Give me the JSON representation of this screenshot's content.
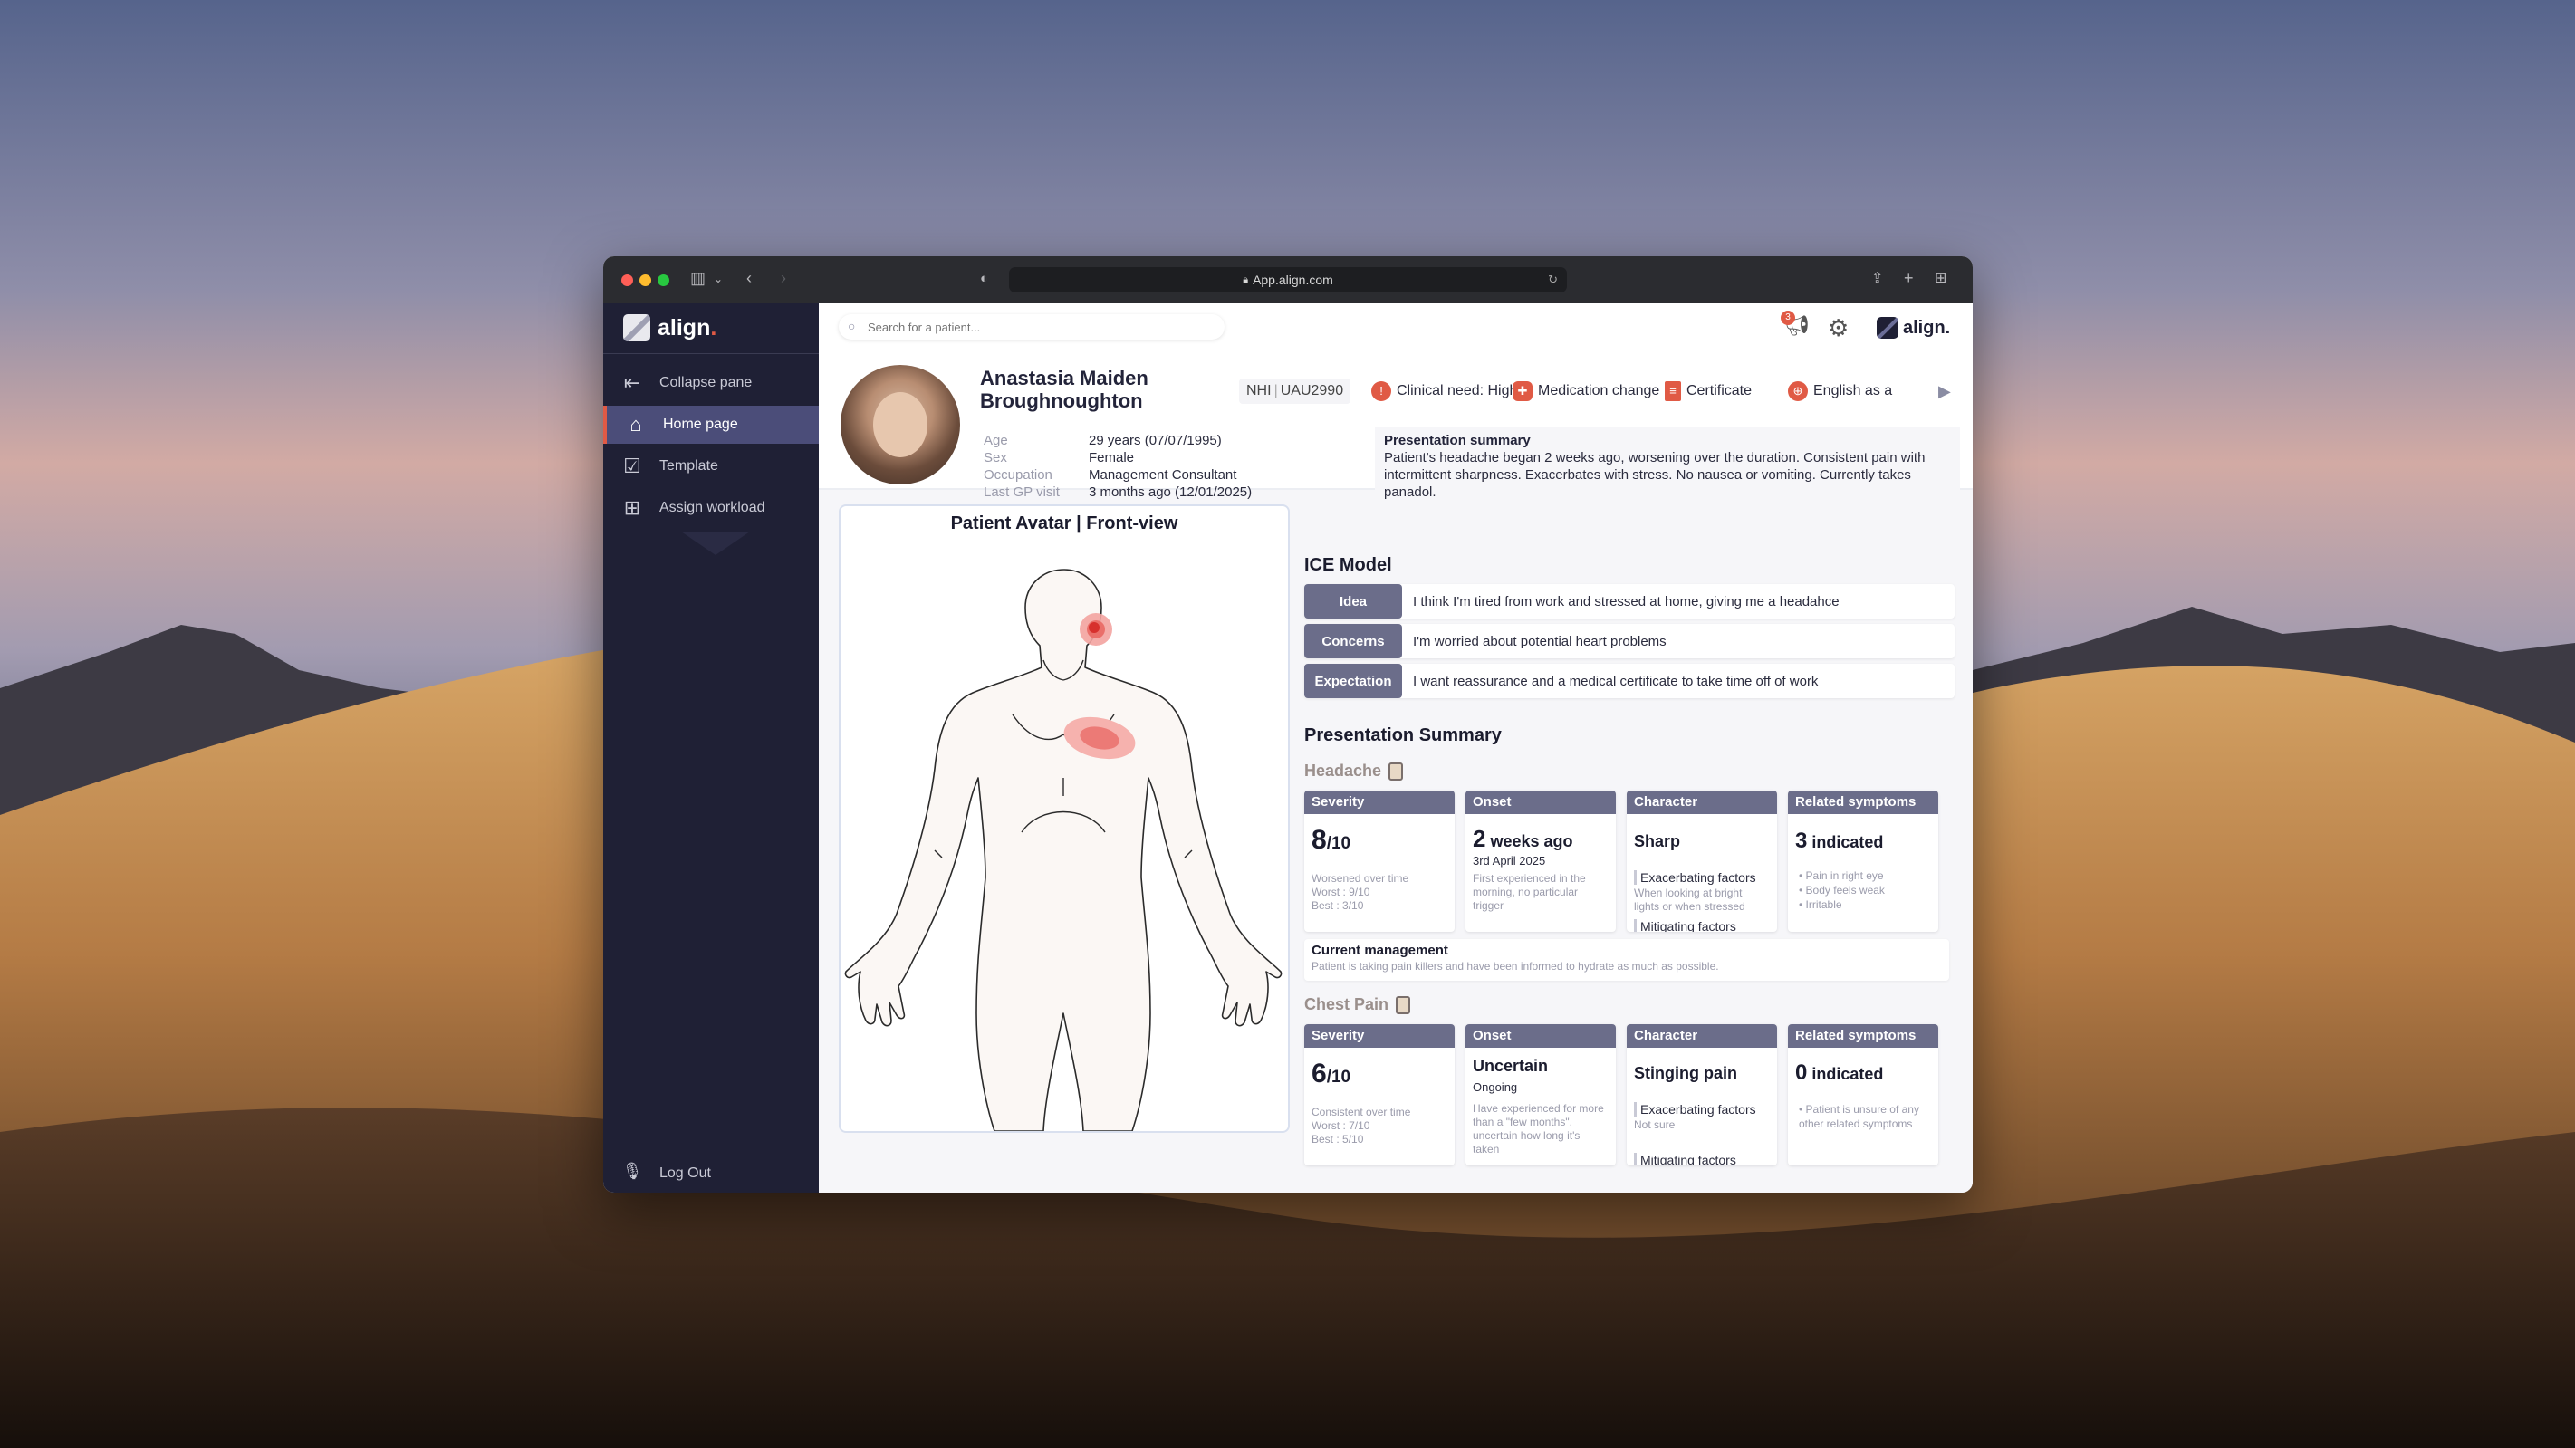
{
  "browser": {
    "url": "App.align.com"
  },
  "sidebar": {
    "logo_text": "align",
    "logo_dot": ".",
    "items": [
      {
        "label": "Collapse pane",
        "icon": "collapse-arrow-icon"
      },
      {
        "label": "Home page",
        "icon": "home-icon"
      },
      {
        "label": "Template",
        "icon": "template-icon"
      },
      {
        "label": "Assign workload",
        "icon": "clipboard-plus-icon"
      }
    ],
    "logout_label": "Log Out"
  },
  "topbar": {
    "search_placeholder": "Search for a patient...",
    "notification_count": "3",
    "logo_text": "align."
  },
  "patient": {
    "name": "Anastasia Maiden Broughnoughton",
    "nhi_label": "NHI",
    "nhi_value": "UAU2990",
    "tags": [
      {
        "label": "Clinical need: High",
        "icon": "clinical-need-icon",
        "color": "#e05a45"
      },
      {
        "label": "Medication change",
        "icon": "pills-icon",
        "color": "#e05a45"
      },
      {
        "label": "Certificate",
        "icon": "certificate-icon",
        "color": "#e05a45"
      },
      {
        "label": "English as a",
        "icon": "globe-icon",
        "color": "#e05a45"
      }
    ],
    "info": [
      {
        "key": "Age",
        "value": "29 years (07/07/1995)"
      },
      {
        "key": "Sex",
        "value": "Female"
      },
      {
        "key": "Occupation",
        "value": "Management Consultant"
      },
      {
        "key": "Last GP visit",
        "value": "3 months ago (12/01/2025)"
      }
    ],
    "presentation_summary_title": "Presentation summary",
    "presentation_summary_text": "Patient's headache began 2 weeks ago, worsening over the duration. Consistent pain with intermittent sharpness. Exacerbates with stress. No nausea or vomiting. Currently takes panadol."
  },
  "avatar_panel": {
    "title": "Patient Avatar | Front-view"
  },
  "ice": {
    "title": "ICE Model",
    "rows": [
      {
        "label": "Idea",
        "text": "I think I'm tired from work and stressed at home, giving me a headahce"
      },
      {
        "label": "Concerns",
        "text": "I'm worried about potential heart problems"
      },
      {
        "label": "Expectation",
        "text": "I want reassurance and a medical certificate to take time off of work"
      }
    ]
  },
  "presentation": {
    "title": "Presentation Summary",
    "headache": {
      "title": "Headache",
      "severity_head": "Severity",
      "severity_value": "8",
      "severity_denom": "/10",
      "severity_notes": [
        "Worsened over time",
        "Worst : 9/10",
        "Best : 3/10"
      ],
      "onset_head": "Onset",
      "onset_value": "2",
      "onset_unit": " weeks ago",
      "onset_date": "3rd April 2025",
      "onset_note": "First experienced in the morning, no particular trigger",
      "character_head": "Character",
      "character_value": "Sharp",
      "exacerbating_label": "Exacerbating factors",
      "exacerbating_text": "When looking at bright lights or when stressed",
      "mitigating_label": "Mitigating factors",
      "related_head": "Related symptoms",
      "related_count": "3",
      "related_unit": " indicated",
      "related_list": [
        "Pain in right eye",
        "Body feels weak",
        "Irritable"
      ],
      "management_title": "Current management",
      "management_text": "Patient is taking pain killers and have been informed to hydrate as much as possible."
    },
    "chest_pain": {
      "title": "Chest Pain",
      "severity_head": "Severity",
      "severity_value": "6",
      "severity_denom": "/10",
      "severity_notes": [
        "Consistent over time",
        "Worst : 7/10",
        "Best : 5/10"
      ],
      "onset_head": "Onset",
      "onset_value": "Uncertain",
      "onset_sub": "Ongoing",
      "onset_note": "Have experienced for more than a \"few months\", uncertain how long it's taken",
      "character_head": "Character",
      "character_value": "Stinging pain",
      "exacerbating_label": "Exacerbating factors",
      "exacerbating_text": "Not sure",
      "mitigating_label": "Mitigating factors",
      "related_head": "Related symptoms",
      "related_count": "0",
      "related_unit": " indicated",
      "related_list": [
        "Patient is unsure of any other related symptoms"
      ]
    }
  }
}
